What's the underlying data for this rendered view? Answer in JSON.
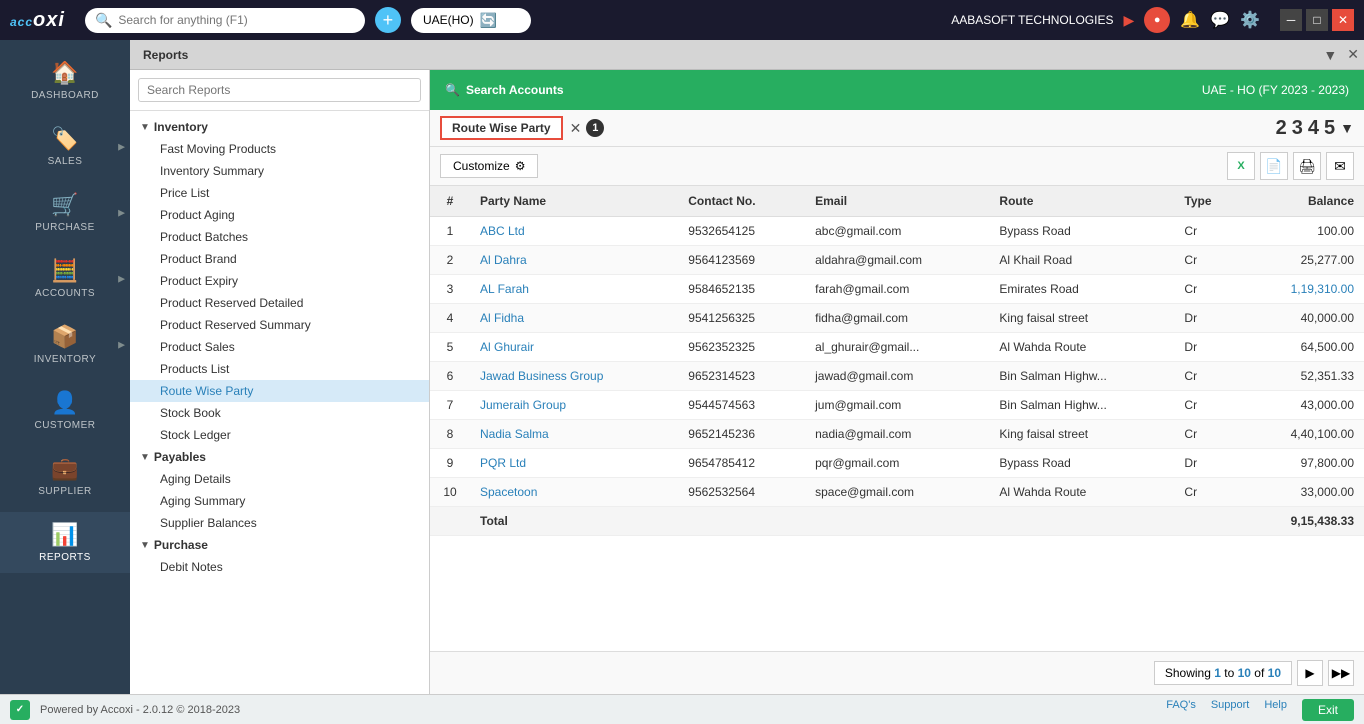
{
  "app": {
    "logo": "accoxi",
    "search_placeholder": "Search for anything (F1)",
    "company": "UAE(HO)",
    "company_label": "AABASOFT TECHNOLOGIES",
    "window_title": "Reports"
  },
  "sidebar": {
    "items": [
      {
        "id": "dashboard",
        "label": "DASHBOARD",
        "icon": "🏠",
        "has_arrow": false
      },
      {
        "id": "sales",
        "label": "SALES",
        "icon": "🏷️",
        "has_arrow": true
      },
      {
        "id": "purchase",
        "label": "PURCHASE",
        "icon": "🛒",
        "has_arrow": true
      },
      {
        "id": "accounts",
        "label": "ACCOUNTS",
        "icon": "🧮",
        "has_arrow": true
      },
      {
        "id": "inventory",
        "label": "INVENTORY",
        "icon": "📦",
        "has_arrow": true
      },
      {
        "id": "customer",
        "label": "CUSTOMER",
        "icon": "👤",
        "has_arrow": false
      },
      {
        "id": "supplier",
        "label": "SUPPLIER",
        "icon": "💼",
        "has_arrow": false
      },
      {
        "id": "reports",
        "label": "REPORTS",
        "icon": "📊",
        "has_arrow": false
      }
    ]
  },
  "reports_tab": "Reports",
  "search_reports_placeholder": "Search Reports",
  "tree": {
    "groups": [
      {
        "label": "Inventory",
        "expanded": true,
        "items": [
          "Fast Moving Products",
          "Inventory Summary",
          "Price List",
          "Product Aging",
          "Product Batches",
          "Product Brand",
          "Product Expiry",
          "Product Reserved Detailed",
          "Product Reserved Summary",
          "Product Sales",
          "Products List",
          "Route Wise Party",
          "Stock Book",
          "Stock Ledger"
        ]
      },
      {
        "label": "Payables",
        "expanded": true,
        "items": [
          "Aging Details",
          "Aging Summary",
          "Supplier Balances"
        ]
      },
      {
        "label": "Purchase",
        "expanded": true,
        "items": [
          "Debit Notes"
        ]
      }
    ]
  },
  "green_header": {
    "search_accounts": "Search Accounts",
    "company_info": "UAE - HO (FY 2023 - 2023)"
  },
  "active_report": {
    "name": "Route Wise Party",
    "tab_number": "1"
  },
  "toolbar": {
    "customize": "Customize",
    "page_numbers": [
      "2",
      "3",
      "4",
      "5"
    ]
  },
  "table": {
    "columns": [
      "#",
      "Party Name",
      "Contact No.",
      "Email",
      "Route",
      "Type",
      "Balance"
    ],
    "rows": [
      {
        "num": "1",
        "party": "ABC Ltd",
        "contact": "9532654125",
        "email": "abc@gmail.com",
        "route": "Bypass Road",
        "type": "Cr",
        "balance": "100.00",
        "balance_colored": false
      },
      {
        "num": "2",
        "party": "Al Dahra",
        "contact": "9564123569",
        "email": "aldahra@gmail.com",
        "route": "Al Khail Road",
        "type": "Cr",
        "balance": "25,277.00",
        "balance_colored": false
      },
      {
        "num": "3",
        "party": "AL Farah",
        "contact": "9584652135",
        "email": "farah@gmail.com",
        "route": "Emirates Road",
        "type": "Cr",
        "balance": "1,19,310.00",
        "balance_colored": true
      },
      {
        "num": "4",
        "party": "Al Fidha",
        "contact": "9541256325",
        "email": "fidha@gmail.com",
        "route": "King faisal street",
        "type": "Dr",
        "balance": "40,000.00",
        "balance_colored": false
      },
      {
        "num": "5",
        "party": "Al Ghurair",
        "contact": "9562352325",
        "email": "al_ghurair@gmail...",
        "route": "Al Wahda Route",
        "type": "Dr",
        "balance": "64,500.00",
        "balance_colored": false
      },
      {
        "num": "6",
        "party": "Jawad Business Group",
        "contact": "9652314523",
        "email": "jawad@gmail.com",
        "route": "Bin Salman Highw...",
        "type": "Cr",
        "balance": "52,351.33",
        "balance_colored": false
      },
      {
        "num": "7",
        "party": "Jumeraih Group",
        "contact": "9544574563",
        "email": "jum@gmail.com",
        "route": "Bin Salman Highw...",
        "type": "Cr",
        "balance": "43,000.00",
        "balance_colored": false
      },
      {
        "num": "8",
        "party": "Nadia Salma",
        "contact": "9652145236",
        "email": "nadia@gmail.com",
        "route": "King faisal street",
        "type": "Cr",
        "balance": "4,40,100.00",
        "balance_colored": false
      },
      {
        "num": "9",
        "party": "PQR Ltd",
        "contact": "9654785412",
        "email": "pqr@gmail.com",
        "route": "Bypass Road",
        "type": "Dr",
        "balance": "97,800.00",
        "balance_colored": false
      },
      {
        "num": "10",
        "party": "Spacetoon",
        "contact": "9562532564",
        "email": "space@gmail.com",
        "route": "Al Wahda Route",
        "type": "Cr",
        "balance": "33,000.00",
        "balance_colored": false
      }
    ],
    "total_label": "Total",
    "total_balance": "9,15,438.33"
  },
  "pagination": {
    "showing_text": "Showing ",
    "range_start": "1",
    "range_to": " to ",
    "range_end": "10",
    "of_text": " of ",
    "total": "10"
  },
  "footer": {
    "powered_by": "Powered by Accoxi - 2.0.12 © 2018-2023",
    "links": [
      "FAQ's",
      "Support",
      "Help"
    ],
    "exit_label": "Exit"
  },
  "colors": {
    "green": "#27ae60",
    "blue": "#2980b9",
    "red": "#e74c3c",
    "sidebar_bg": "#2c3e50"
  }
}
